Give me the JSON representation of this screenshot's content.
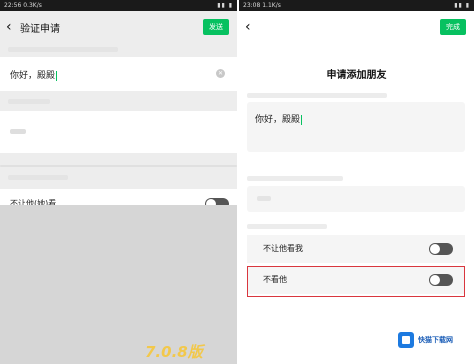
{
  "left": {
    "status": {
      "time": "22:56",
      "speed": "0.3K/s",
      "icons": "▮▮ ▮"
    },
    "nav": {
      "title": "验证申请",
      "action": "发送"
    },
    "message_value": "你好，殿殿",
    "row_label": "不让他(她)看",
    "version_badge": "7.0.8版"
  },
  "right": {
    "status": {
      "time": "23:08",
      "speed": "1.1K/s",
      "icons": "▮▮ ▮"
    },
    "nav": {
      "action": "完成"
    },
    "title": "申请添加朋友",
    "message_value": "你好，殿殿",
    "row1_label": "不让他看我",
    "row2_label": "不看他"
  },
  "watermark": {
    "name": "快猫下载网"
  },
  "colors": {
    "accent": "#07c160",
    "highlight": "#d9363e"
  }
}
